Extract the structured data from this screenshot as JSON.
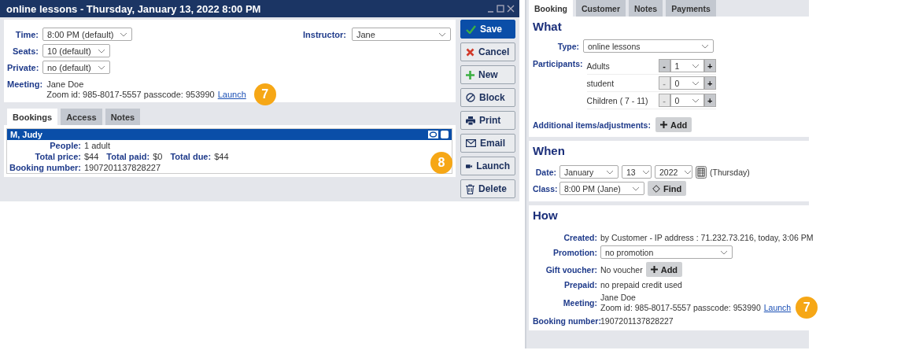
{
  "window": {
    "title": "online lessons - Thursday, January 13, 2022 8:00 PM"
  },
  "event_form": {
    "fields": [
      {
        "label": "Time:",
        "value": "8:00 PM (default)"
      },
      {
        "label": "Seats:",
        "value": "10 (default)"
      },
      {
        "label": "Private:",
        "value": "no (default)"
      }
    ],
    "instructor": {
      "label": "Instructor:",
      "value": "Jane"
    },
    "meeting": {
      "label": "Meeting:",
      "name": "Jane Doe",
      "details": "Zoom id: 985-8017-5557 passcode: 953990",
      "link": "Launch",
      "callout": "7"
    }
  },
  "tabs": [
    {
      "label": "Bookings",
      "selected": true
    },
    {
      "label": "Access",
      "selected": false
    },
    {
      "label": "Notes",
      "selected": false
    }
  ],
  "booking": {
    "name": "M, Judy",
    "checked": false,
    "people_label": "People:",
    "people": "1 adult",
    "totals": [
      {
        "label": "Total price:",
        "value": "$44"
      },
      {
        "label": "Total paid:",
        "value": "$0"
      },
      {
        "label": "Total due:",
        "value": "$44"
      }
    ],
    "number_label": "Booking number:",
    "number": "1907201137828227",
    "callout": "8"
  },
  "actions": [
    {
      "label": "Save",
      "kind": "save"
    },
    {
      "label": "Cancel",
      "kind": "cancel"
    },
    {
      "label": "New",
      "kind": "new"
    },
    {
      "label": "Block",
      "kind": "block"
    },
    {
      "label": "Print",
      "kind": "print"
    },
    {
      "label": "Email",
      "kind": "email"
    },
    {
      "label": "Launch",
      "kind": "launch"
    },
    {
      "label": "Delete",
      "kind": "delete"
    }
  ],
  "detail_tabs": [
    {
      "label": "Booking",
      "selected": true
    },
    {
      "label": "Customer",
      "selected": false
    },
    {
      "label": "Notes",
      "selected": false
    },
    {
      "label": "Payments",
      "selected": false
    }
  ],
  "what": {
    "title": "What",
    "type_label": "Type:",
    "type": "online lessons",
    "participants_label": "Participants:",
    "participants": [
      {
        "label": "Adults",
        "value": "1",
        "decrement": "-",
        "increment": "+",
        "decrement_disabled": false
      },
      {
        "label": "student",
        "value": "0",
        "decrement": "-",
        "increment": "+",
        "decrement_disabled": true
      },
      {
        "label": "Children ( 7 - 11)",
        "value": "0",
        "decrement": "-",
        "increment": "+",
        "decrement_disabled": true
      }
    ],
    "additional_label": "Additional items/adjustments:",
    "add_button": "Add"
  },
  "when": {
    "title": "When",
    "date_label": "Date:",
    "month": "January",
    "day": "13",
    "year": "2022",
    "weekday": "(Thursday)",
    "class_label": "Class:",
    "class": "8:00 PM (Jane)",
    "find_button": "Find"
  },
  "how": {
    "title": "How",
    "created_label": "Created:",
    "created": "by Customer - IP address : 71.232.73.216, today, 3:06 PM",
    "promotion_label": "Promotion:",
    "promotion": "no promotion",
    "voucher_label": "Gift voucher:",
    "voucher": "No voucher",
    "voucher_button": "Add",
    "prepaid_label": "Prepaid:",
    "prepaid": "no prepaid credit used",
    "meeting": {
      "label": "Meeting:",
      "name": "Jane Doe",
      "details": "Zoom id: 985-8017-5557 passcode: 953990",
      "link": "Launch",
      "callout": "7"
    },
    "number_label": "Booking number:",
    "number": "1907201137828227"
  }
}
